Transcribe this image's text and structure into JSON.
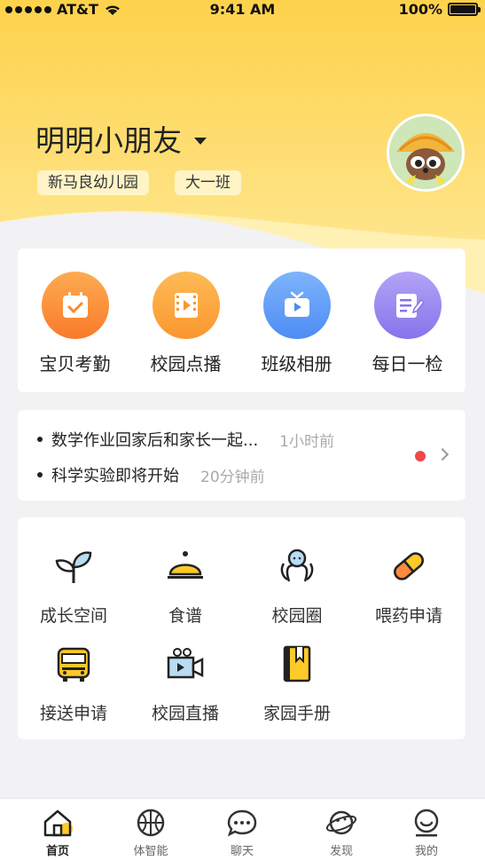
{
  "status_bar": {
    "carrier": "AT&T",
    "time": "9:41 AM",
    "battery": "100%"
  },
  "header": {
    "child_name": "明明小朋友",
    "school": "新马良幼儿园",
    "class_name": "大一班"
  },
  "quick_actions": [
    {
      "label": "宝贝考勤",
      "icon": "calendar-check-icon",
      "color": "#fb8a2e"
    },
    {
      "label": "校园点播",
      "icon": "film-play-icon",
      "color": "#fda23b"
    },
    {
      "label": "班级相册",
      "icon": "tv-play-icon",
      "color": "#5e9cf7"
    },
    {
      "label": "每日一检",
      "icon": "note-edit-icon",
      "color": "#9a87f0"
    }
  ],
  "notices": [
    {
      "text": "数学作业回家后和家长一起...",
      "time": "1小时前"
    },
    {
      "text": "科学实验即将开始",
      "time": "20分钟前"
    }
  ],
  "services": [
    {
      "label": "成长空间",
      "icon": "sprout-icon"
    },
    {
      "label": "食谱",
      "icon": "food-cloche-icon"
    },
    {
      "label": "校园圈",
      "icon": "people-circle-icon"
    },
    {
      "label": "喂药申请",
      "icon": "pill-icon"
    },
    {
      "label": "接送申请",
      "icon": "school-bus-icon"
    },
    {
      "label": "校园直播",
      "icon": "video-camera-icon"
    },
    {
      "label": "家园手册",
      "icon": "handbook-icon"
    }
  ],
  "tabs": [
    {
      "label": "首页",
      "icon": "home-icon",
      "active": true
    },
    {
      "label": "体智能",
      "icon": "basketball-icon",
      "active": false
    },
    {
      "label": "聊天",
      "icon": "chat-bubble-icon",
      "active": false
    },
    {
      "label": "发现",
      "icon": "planet-icon",
      "active": false
    },
    {
      "label": "我的",
      "icon": "profile-icon",
      "active": false
    }
  ],
  "colors": {
    "accent_yellow": "#fdd24b",
    "hero_light": "#fff2bd",
    "active_dot": "#f04848",
    "notice_time": "#aaaaaa"
  }
}
